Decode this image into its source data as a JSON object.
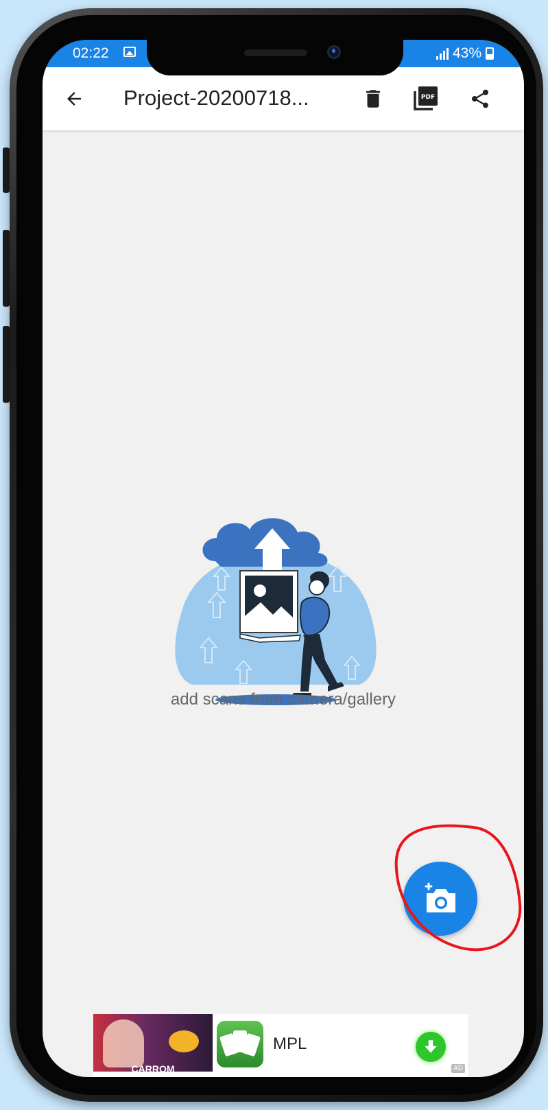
{
  "status_bar": {
    "time": "02:22",
    "battery": "43%",
    "icons": [
      "gallery-icon",
      "signal-icon",
      "battery-icon"
    ]
  },
  "app_bar": {
    "title": "Project-20200718...",
    "icons": [
      "back-arrow-icon",
      "trash-icon",
      "pdf-icon",
      "share-icon"
    ]
  },
  "empty_state": {
    "message": "add scans from camera/gallery"
  },
  "fab": {
    "icon": "add-camera-icon"
  },
  "ad": {
    "thumbnail_label": "CARROM",
    "title": "MPL",
    "badge": "AD",
    "icon": "download-icon"
  },
  "colors": {
    "primary": "#1a83e6",
    "background": "#f1f1f1",
    "app_bar": "#ffffff",
    "page_background": "#c9e6fb",
    "highlight": "#e8161b",
    "illustration_light": "#9ccaee",
    "illustration_dark": "#3b73c0"
  }
}
